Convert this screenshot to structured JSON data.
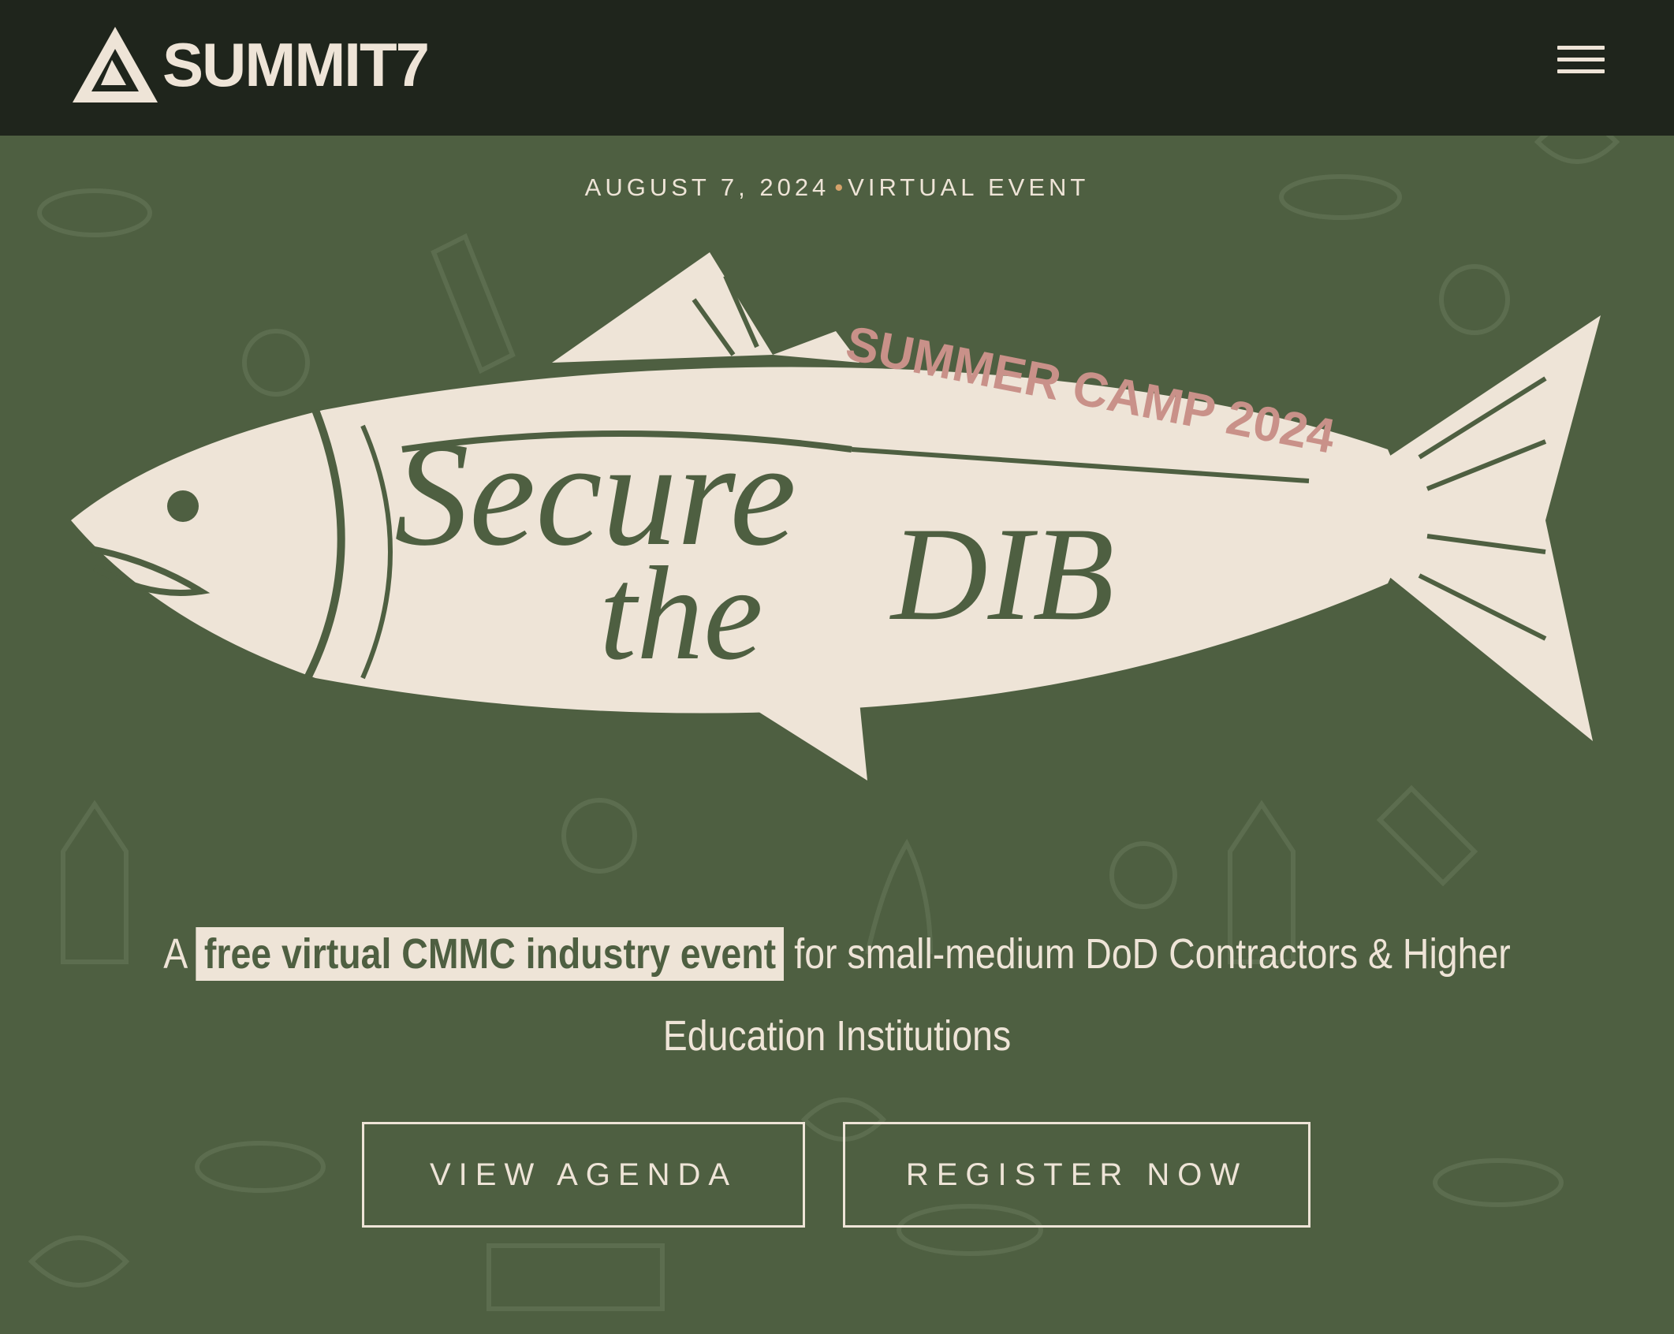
{
  "header": {
    "brand": "SUMMIT7",
    "menu_icon": "hamburger-menu-icon"
  },
  "hero": {
    "date": "AUGUST 7, 2024",
    "separator": "•",
    "event_type": "VIRTUAL EVENT",
    "banner_arc": "SUMMER CAMP 2024",
    "script_line1": "Secure",
    "script_line2": "the",
    "script_line3": "DIB",
    "tagline_prefix": "A",
    "tagline_highlight": "free virtual CMMC industry event",
    "tagline_rest": "for small-medium DoD Contractors & Higher Education Institutions"
  },
  "actions": {
    "agenda_label": "VIEW AGENDA",
    "register_label": "REGISTER NOW"
  },
  "colors": {
    "background": "#4e5f41",
    "header": "#1f251c",
    "cream": "#eee4d7",
    "pink": "#c99189",
    "accent_dot": "#d5a26a"
  }
}
